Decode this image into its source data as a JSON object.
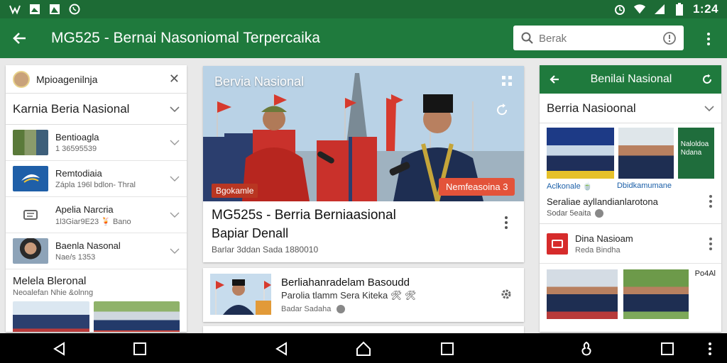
{
  "status": {
    "time": "1:24",
    "left_icons": [
      "vine-icon",
      "image-icon",
      "photo-icon",
      "whatsapp-icon"
    ],
    "right_icons": [
      "alarm-icon",
      "wifi-icon",
      "signal-icon",
      "battery-icon"
    ]
  },
  "appbar": {
    "title": "MG525 - Bernai Nasoniomal Terpercaika",
    "search_placeholder": "Berak",
    "color": "#1f7a3d"
  },
  "left_panel": {
    "header": "Mpioagenilnja",
    "category": "Karnia Beria Nasional",
    "items": [
      {
        "name": "Bentioagla",
        "sub": "1 36595539"
      },
      {
        "name": "Remtodiaia",
        "sub": "Zápla 196l bdlon- Thral"
      },
      {
        "name": "Apelia Narcria",
        "sub": "1l3Giar9E23 🍹 Bano"
      },
      {
        "name": "Baenla Nasonal",
        "sub": "Nae/s 1353"
      }
    ],
    "footer_title": "Melela Bleronal",
    "footer_sub": "Neoalefan Nhie &olnng"
  },
  "main": {
    "hero_label": "Bervia Nasional",
    "hero_badge_left": "Bgokamle",
    "hero_badge_right": "Nemfeasoina 3",
    "headline1": "MG525s - Berria Berniaasional",
    "headline2": "Bapiar Denall",
    "meta": "Barlar 3ddan   Sada 1880010"
  },
  "card2": {
    "name": "Berliahanradelam Basoudd",
    "sub": "Parolia tlamm Sera Kiteka 🛠 🛠",
    "meta": "Badar Sadaha"
  },
  "right_panel": {
    "header": "Benilai Nasional",
    "category": "Berria Nasioonal",
    "thumb_caption_left": "Aclkonale 🍵",
    "thumb_caption_right": "Dbidkamumane",
    "thumb_overlay": "Naloldoa Ndana",
    "headline": "Seraliae ayllandianlarotona",
    "meta": "Sodar 5eaita",
    "item_name": "Dina Nasioam",
    "item_sub": "Reda Bindha",
    "photos_label": "Po4Al"
  }
}
